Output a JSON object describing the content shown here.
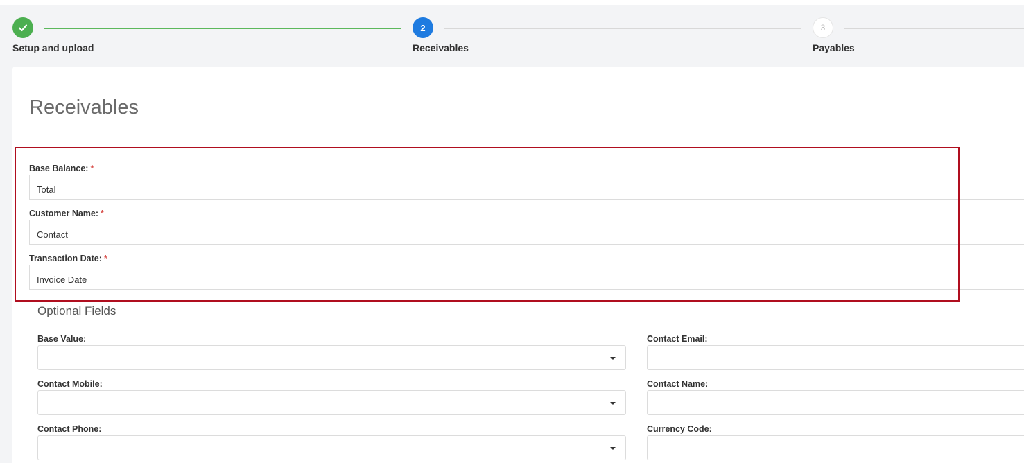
{
  "stepper": {
    "steps": [
      {
        "number": "",
        "label": "Setup and upload",
        "state": "done",
        "icon": "check-icon"
      },
      {
        "number": "2",
        "label": "Receivables",
        "state": "active"
      },
      {
        "number": "3",
        "label": "Payables",
        "state": "todo"
      }
    ]
  },
  "page": {
    "title": "Receivables"
  },
  "required_fields": [
    {
      "label": "Base Balance:",
      "required_mark": "*",
      "value": "Total"
    },
    {
      "label": "Customer Name:",
      "required_mark": "*",
      "value": "Contact"
    },
    {
      "label": "Transaction Date:",
      "required_mark": "*",
      "value": "Invoice Date"
    }
  ],
  "optional": {
    "title": "Optional Fields",
    "left": [
      {
        "label": "Base Value:",
        "value": ""
      },
      {
        "label": "Contact Mobile:",
        "value": ""
      },
      {
        "label": "Contact Phone:",
        "value": ""
      }
    ],
    "right": [
      {
        "label": "Contact Email:",
        "value": ""
      },
      {
        "label": "Contact Name:",
        "value": ""
      },
      {
        "label": "Currency Code:",
        "value": ""
      }
    ]
  },
  "colors": {
    "done_green": "#4caf50",
    "active_blue": "#1e7be0",
    "highlight_red": "#b00e1f",
    "required_star": "#d9534f"
  }
}
